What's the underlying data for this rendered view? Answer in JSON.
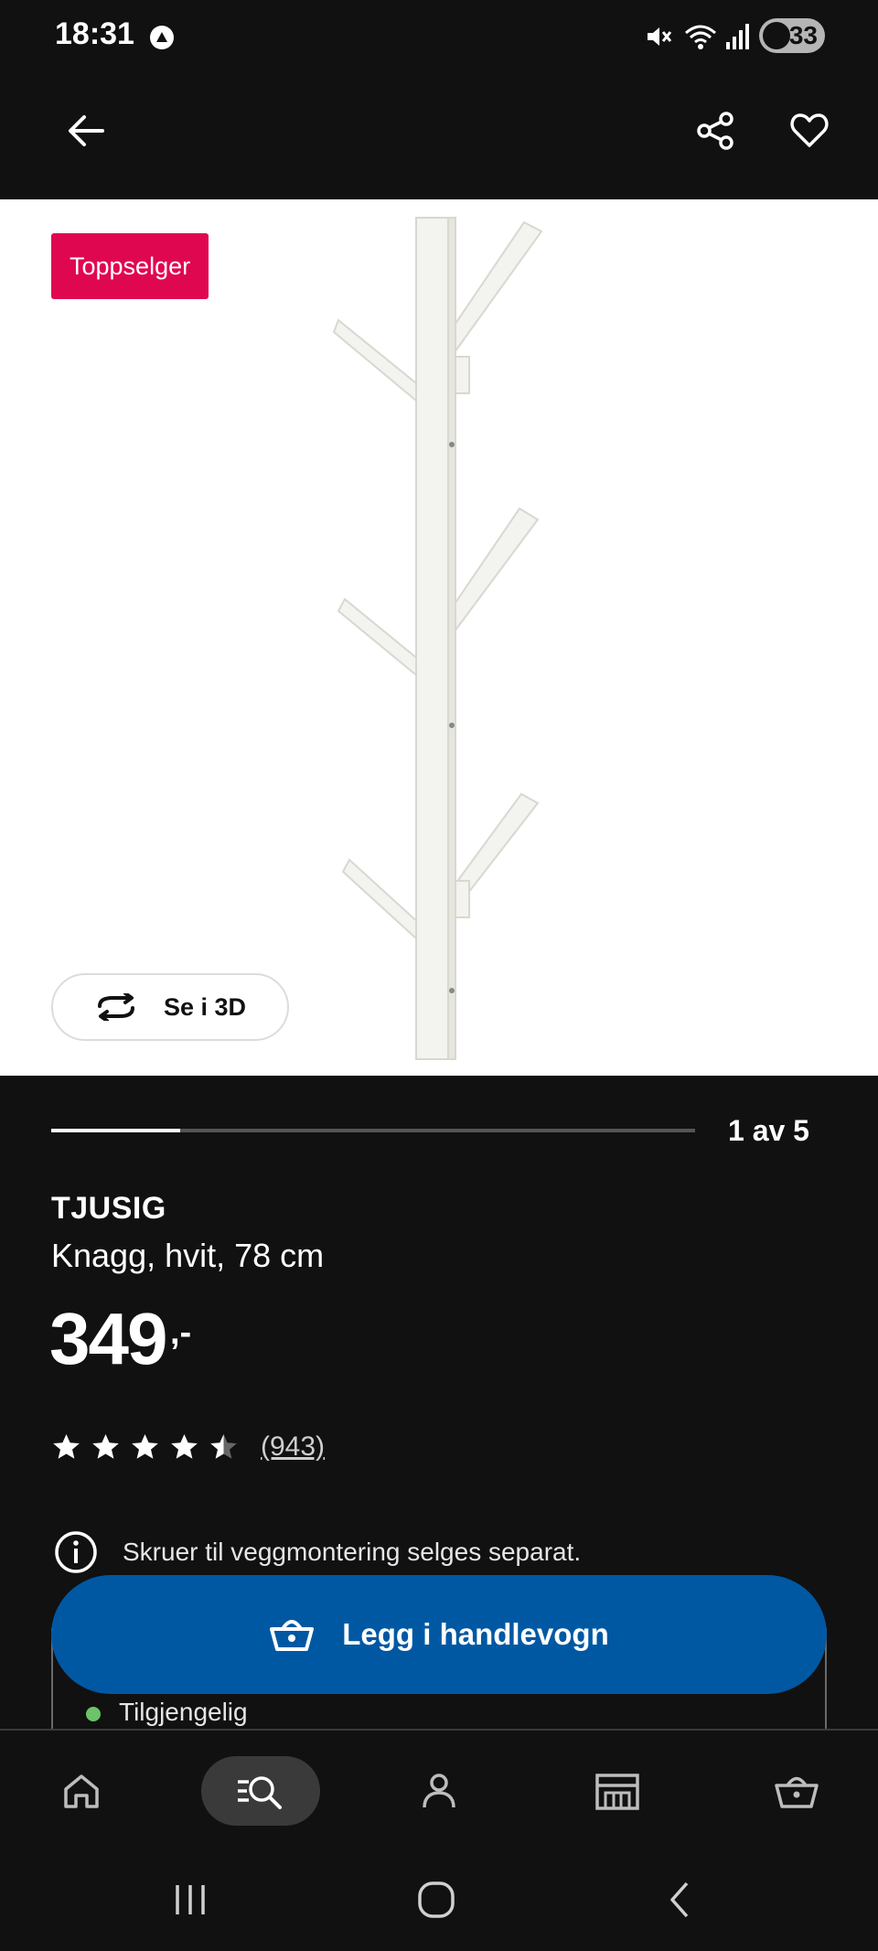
{
  "status_bar": {
    "time": "18:31",
    "battery_level": "33",
    "icons": [
      "notification-app-icon",
      "mute-icon",
      "wifi-icon",
      "signal-icon",
      "battery-icon"
    ]
  },
  "app_bar": {
    "icons": [
      "back-arrow-icon",
      "share-icon",
      "heart-icon"
    ]
  },
  "gallery": {
    "badge": "Toppselger",
    "view_3d_label": "Se i 3D",
    "progress_text": "1 av 5",
    "current_image": 1,
    "total_images": 5
  },
  "product": {
    "name": "TJUSIG",
    "description": "Knagg, hvit, 78 cm",
    "price": "349",
    "price_suffix": ",-",
    "rating": 4.5,
    "review_count": "(943)",
    "info_text": "Skruer til veggmontering selges separat.",
    "availability": "Tilgjengelig"
  },
  "cta": {
    "label": "Legg i handlevogn"
  },
  "bottom_nav": {
    "items": [
      "home-icon",
      "search-icon",
      "profile-icon",
      "store-icon",
      "basket-icon"
    ],
    "active_index": 1
  },
  "system_nav": {
    "items": [
      "recents-icon",
      "home-button-icon",
      "back-icon"
    ]
  },
  "colors": {
    "background": "#111111",
    "badge": "#e00751",
    "primary": "#0058a3",
    "available": "#6cc36a"
  }
}
